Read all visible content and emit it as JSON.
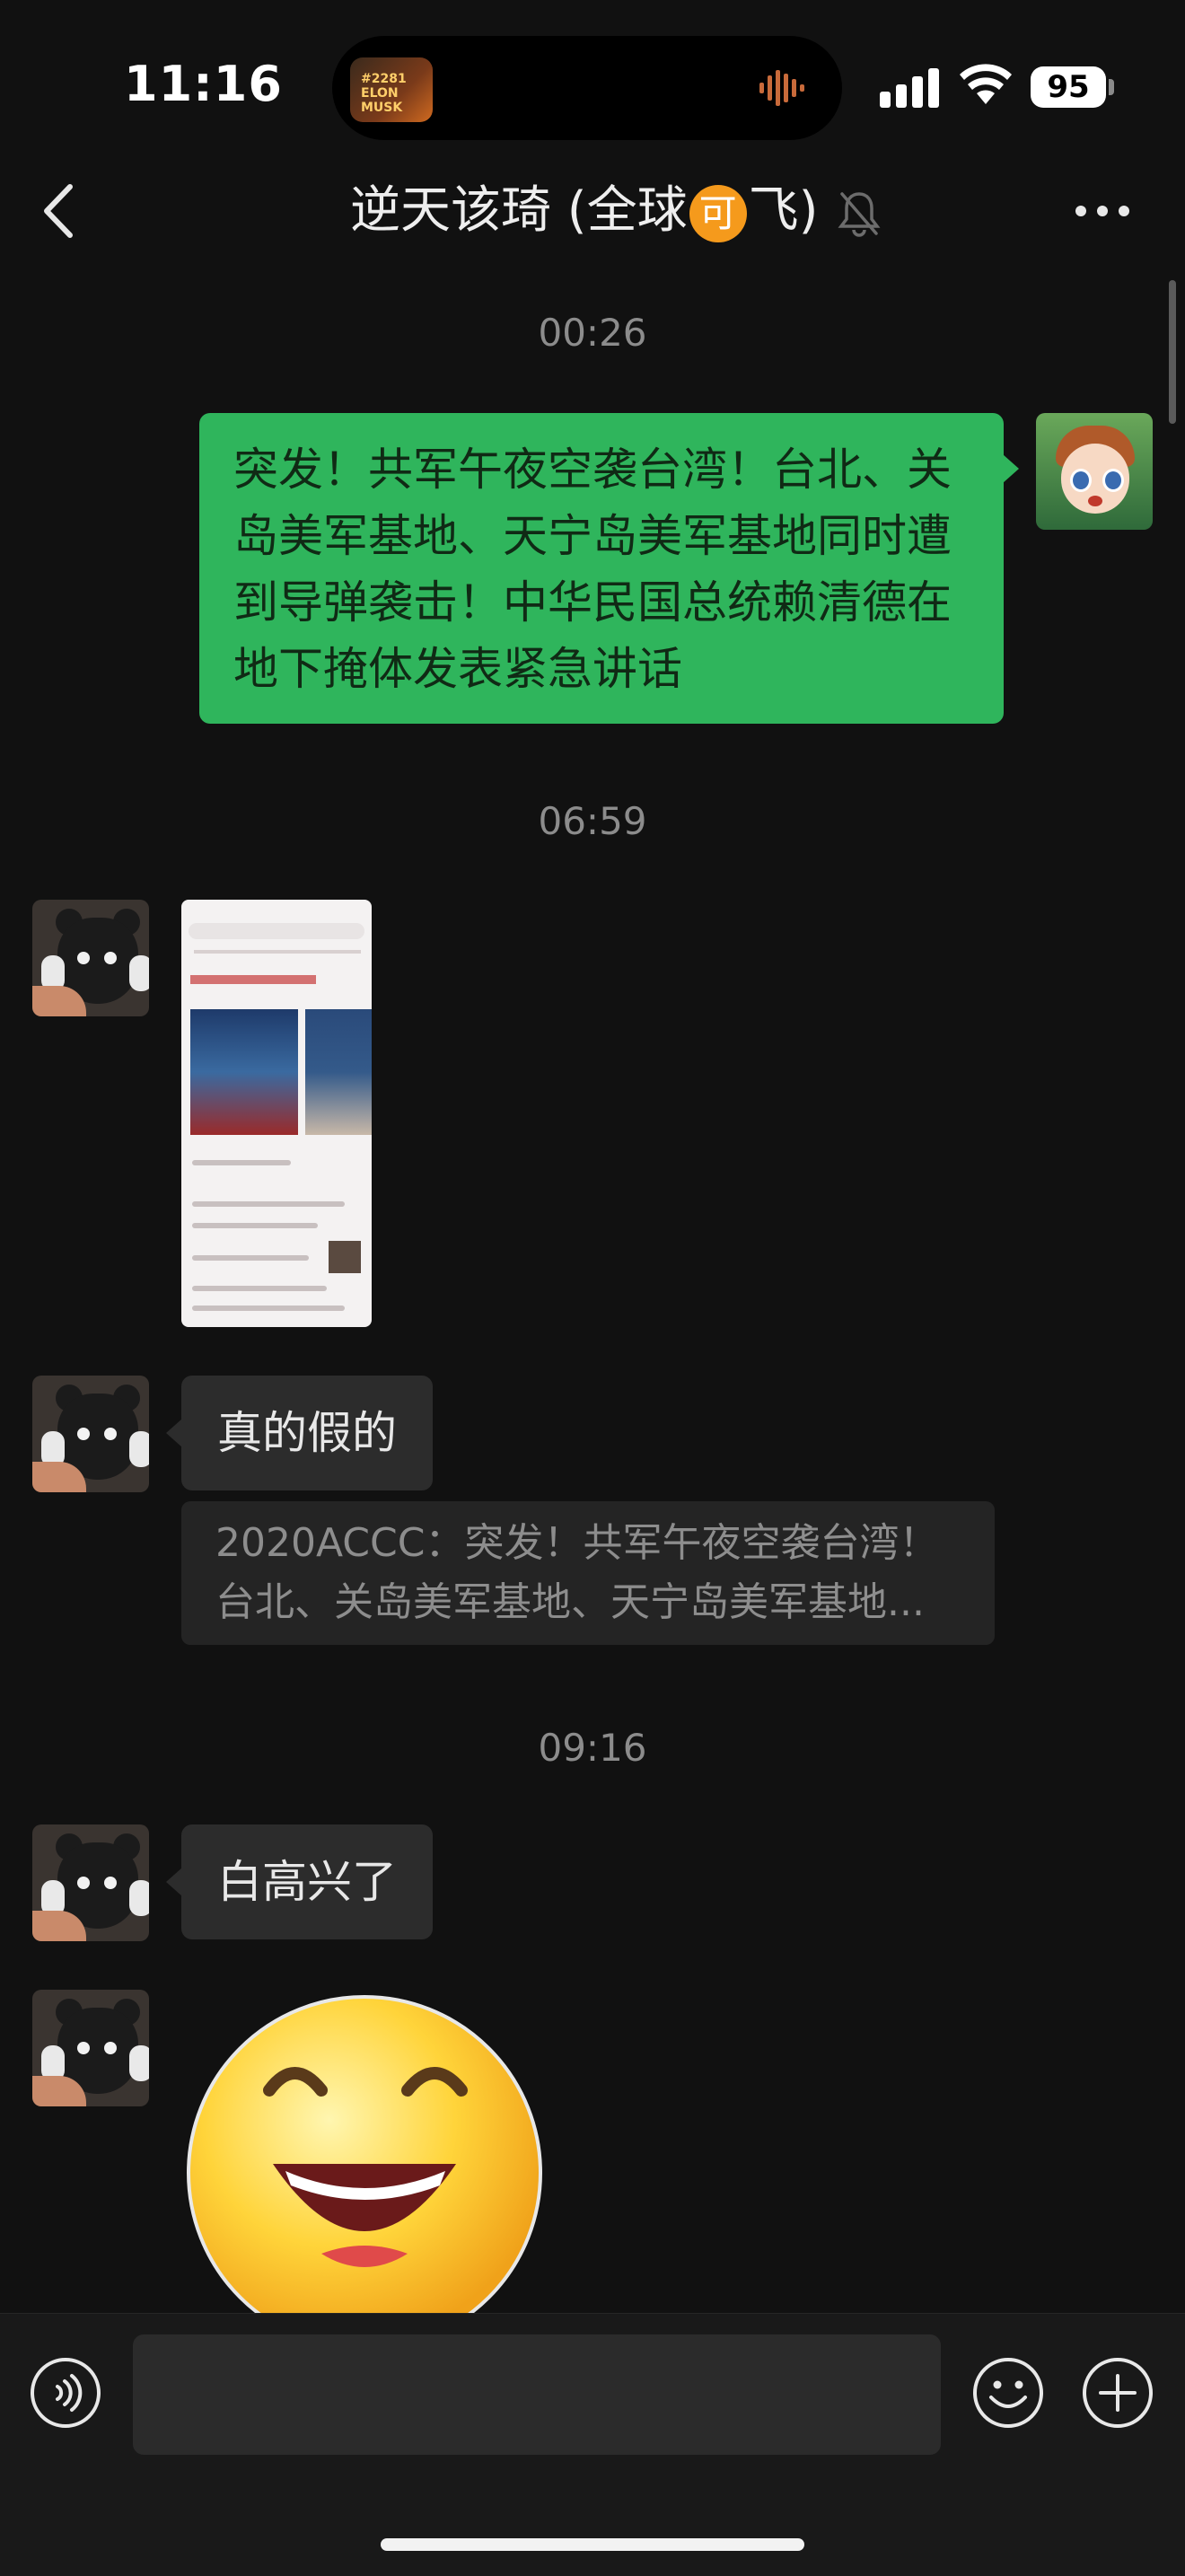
{
  "status_bar": {
    "time": "11:16",
    "battery": "95",
    "now_playing_art_text": "#2281 ELON MUSK"
  },
  "header": {
    "title_pre": "逆天该琦 (全球",
    "title_badge": "可",
    "title_post": "飞)",
    "icons": [
      "back-chevron-icon",
      "mute-bell-icon",
      "more-dots-icon"
    ]
  },
  "messages": [
    {
      "type": "timestamp",
      "text": "00:26"
    },
    {
      "type": "text",
      "sender": "me",
      "text": "突发！共军午夜空袭台湾！台北、关岛美军基地、天宁岛美军基地同时遭到导弹袭击！中华民国总统赖清德在地下掩体发表紧急讲话"
    },
    {
      "type": "timestamp",
      "text": "06:59"
    },
    {
      "type": "image",
      "sender": "other",
      "content": "screenshot-thumbnail"
    },
    {
      "type": "text",
      "sender": "other",
      "text": "真的假的"
    },
    {
      "type": "quote",
      "sender": "other",
      "text": "2020ACCC：突发！共军午夜空袭台湾！台北、关岛美军基地、天宁岛美军基地..."
    },
    {
      "type": "timestamp",
      "text": "09:16"
    },
    {
      "type": "text",
      "sender": "other",
      "text": "白高兴了"
    },
    {
      "type": "sticker",
      "sender": "other",
      "content": "laughing-face-emoji"
    }
  ],
  "input_bar": {
    "icons": [
      "voice-icon",
      "emoji-icon",
      "plus-icon"
    ],
    "field_value": ""
  },
  "colors": {
    "background": "#111111",
    "my_bubble": "#2fb55c",
    "other_bubble": "#2c2c2c",
    "badge": "#f59a1c"
  }
}
